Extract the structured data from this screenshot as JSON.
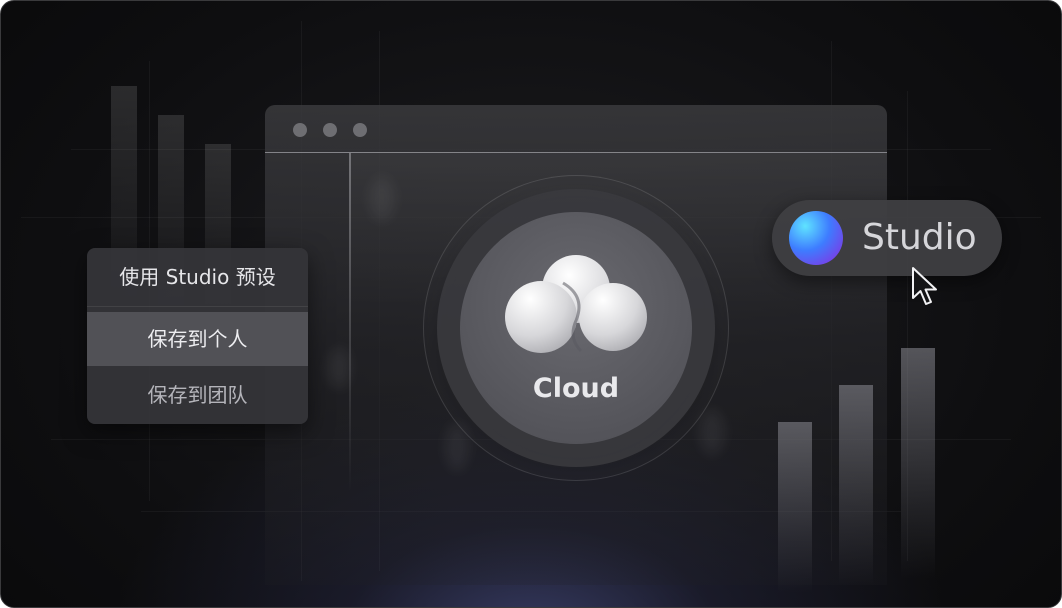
{
  "menu": {
    "preset_label": "使用 Studio 预设",
    "save_personal": "保存到个人",
    "save_team": "保存到团队"
  },
  "cloud": {
    "label": "Cloud"
  },
  "studio": {
    "label": "Studio"
  },
  "icons": {
    "cloud": "cloud-icon",
    "orb": "studio-orb-icon",
    "cursor": "mouse-pointer-icon"
  },
  "colors": {
    "background": "#0e0e10",
    "orb_start": "#5fe3ff",
    "orb_end": "#6b2fd8",
    "glow": "#5860a8"
  }
}
